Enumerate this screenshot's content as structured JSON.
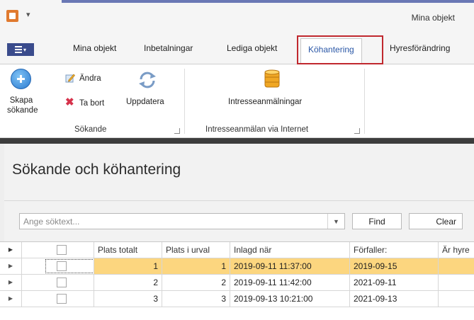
{
  "window": {
    "title": "Mina objekt"
  },
  "menu": {
    "tabs": [
      {
        "label": "Mina objekt"
      },
      {
        "label": "Inbetalningar"
      },
      {
        "label": "Lediga objekt"
      },
      {
        "label": "Köhantering",
        "active": true
      },
      {
        "label": "Hyresförändring"
      }
    ]
  },
  "ribbon": {
    "groups": [
      {
        "label": "Sökande",
        "buttons": {
          "add": {
            "label_line1": "Skapa",
            "label_line2": "sökande",
            "icon": "add-circle-icon"
          },
          "edit": {
            "label": "Ändra",
            "icon": "pencil-icon"
          },
          "delete": {
            "label": "Ta bort",
            "icon": "cross-icon"
          },
          "refresh": {
            "label": "Uppdatera",
            "icon": "refresh-icon"
          }
        }
      },
      {
        "label": "Intresseanmälan via Internet",
        "buttons": {
          "applications": {
            "label": "Intresseanmälningar",
            "icon": "database-icon"
          }
        }
      }
    ]
  },
  "page": {
    "title": "Sökande och köhantering"
  },
  "search": {
    "placeholder": "Ange söktext...",
    "value": "",
    "find_label": "Find",
    "clear_label": "Clear"
  },
  "grid": {
    "columns": [
      "",
      "",
      "Plats totalt",
      "Plats i urval",
      "Inlagd när",
      "Förfaller:",
      "Är hyre"
    ],
    "rows": [
      {
        "plats_totalt": "1",
        "plats_i_urval": "1",
        "inlagd": "2019-09-11 11:37:00",
        "forfaller": "2019-09-15",
        "selected": true
      },
      {
        "plats_totalt": "2",
        "plats_i_urval": "2",
        "inlagd": "2019-09-11 11:42:00",
        "forfaller": "2021-09-11",
        "selected": false
      },
      {
        "plats_totalt": "3",
        "plats_i_urval": "3",
        "inlagd": "2019-09-13 10:21:00",
        "forfaller": "2021-09-13",
        "selected": false
      }
    ]
  },
  "colors": {
    "accent": "#2a57a6",
    "highlight_border": "#c0282e",
    "selected_row": "#fcd67f",
    "file_button": "#3a4b8c"
  }
}
